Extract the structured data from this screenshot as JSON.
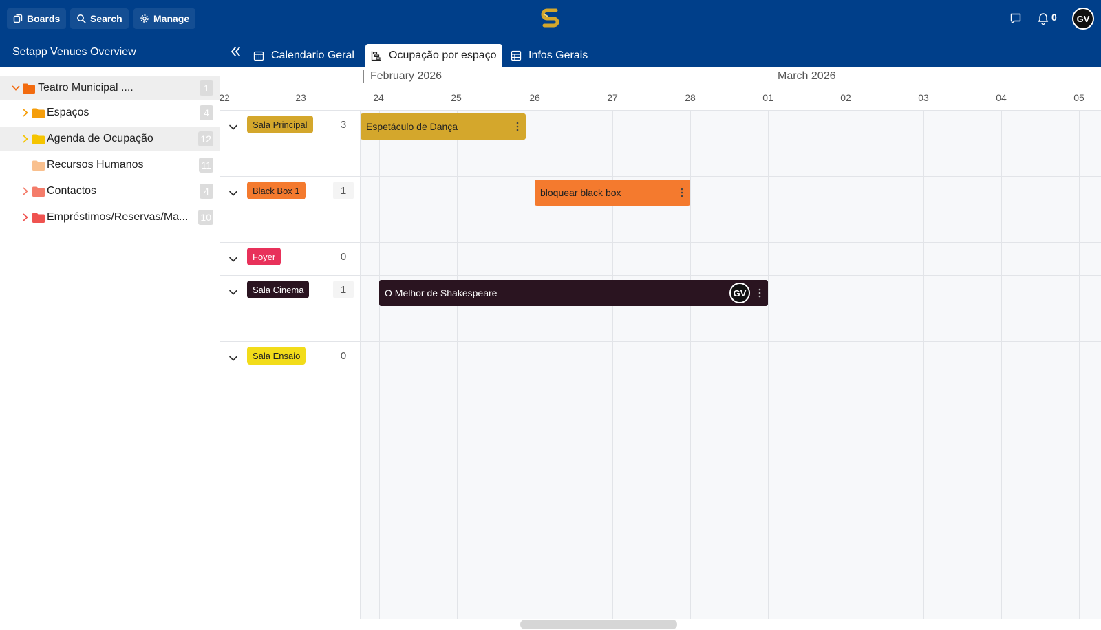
{
  "topbar": {
    "boards_label": "Boards",
    "search_label": "Search",
    "manage_label": "Manage",
    "notifications_count": "0",
    "user_initials": "GV",
    "brand_color": "#003f8a",
    "logo_color": "#d4a72c"
  },
  "workspace": {
    "title": "Setapp Venues Overview",
    "tabs": [
      {
        "label": "Calendario Geral",
        "icon": "calendar-icon",
        "active": false
      },
      {
        "label": "Ocupação por espaço",
        "icon": "gantt-icon",
        "active": true
      },
      {
        "label": "Infos Gerais",
        "icon": "table-icon",
        "active": false
      }
    ]
  },
  "sidebar": {
    "items": [
      {
        "label": "Teatro Municipal ....",
        "count": "1",
        "expanded": true,
        "folder_color": "#f26b0f"
      },
      {
        "label": "Espaços",
        "count": "4",
        "expanded": false,
        "folder_color": "#f59e0b"
      },
      {
        "label": "Agenda de Ocupação",
        "count": "12",
        "expanded": false,
        "folder_color": "#f5c400"
      },
      {
        "label": "Recursos Humanos",
        "count": "11",
        "expanded": false,
        "folder_color": "#f9c08e"
      },
      {
        "label": "Contactos",
        "count": "4",
        "expanded": false,
        "folder_color": "#f47c6a"
      },
      {
        "label": "Empréstimos/Reservas/Ma...",
        "count": "10",
        "expanded": false,
        "folder_color": "#ef5350"
      }
    ]
  },
  "timeline": {
    "months": [
      "February 2026",
      "March 2026"
    ],
    "days": [
      "22",
      "23",
      "24",
      "25",
      "26",
      "27",
      "28",
      "01",
      "02",
      "03",
      "04",
      "05"
    ],
    "rows": [
      {
        "label": "Sala Principal",
        "count": "3",
        "color": "#d4a72c",
        "text_color": "#222222"
      },
      {
        "label": "Black Box 1",
        "count": "1",
        "color": "#f47a2e",
        "text_color": "#222222"
      },
      {
        "label": "Foyer",
        "count": "0",
        "color": "#e8315a",
        "text_color": "#ffffff"
      },
      {
        "label": "Sala Cinema",
        "count": "1",
        "color": "#2a1420",
        "text_color": "#ffffff"
      },
      {
        "label": "Sala Ensaio",
        "count": "0",
        "color": "#f2dc1a",
        "text_color": "#222222"
      }
    ],
    "events": [
      {
        "title": "Espetáculo de Dança",
        "row": 0,
        "color": "#d4a72c",
        "text_color": "#222222",
        "assignee": ""
      },
      {
        "title": "bloquear black box",
        "row": 1,
        "color": "#f47a2e",
        "text_color": "#222222",
        "assignee": ""
      },
      {
        "title": "O Melhor de Shakespeare",
        "row": 3,
        "color": "#2a1420",
        "text_color": "#ffffff",
        "assignee": "GV"
      }
    ]
  }
}
